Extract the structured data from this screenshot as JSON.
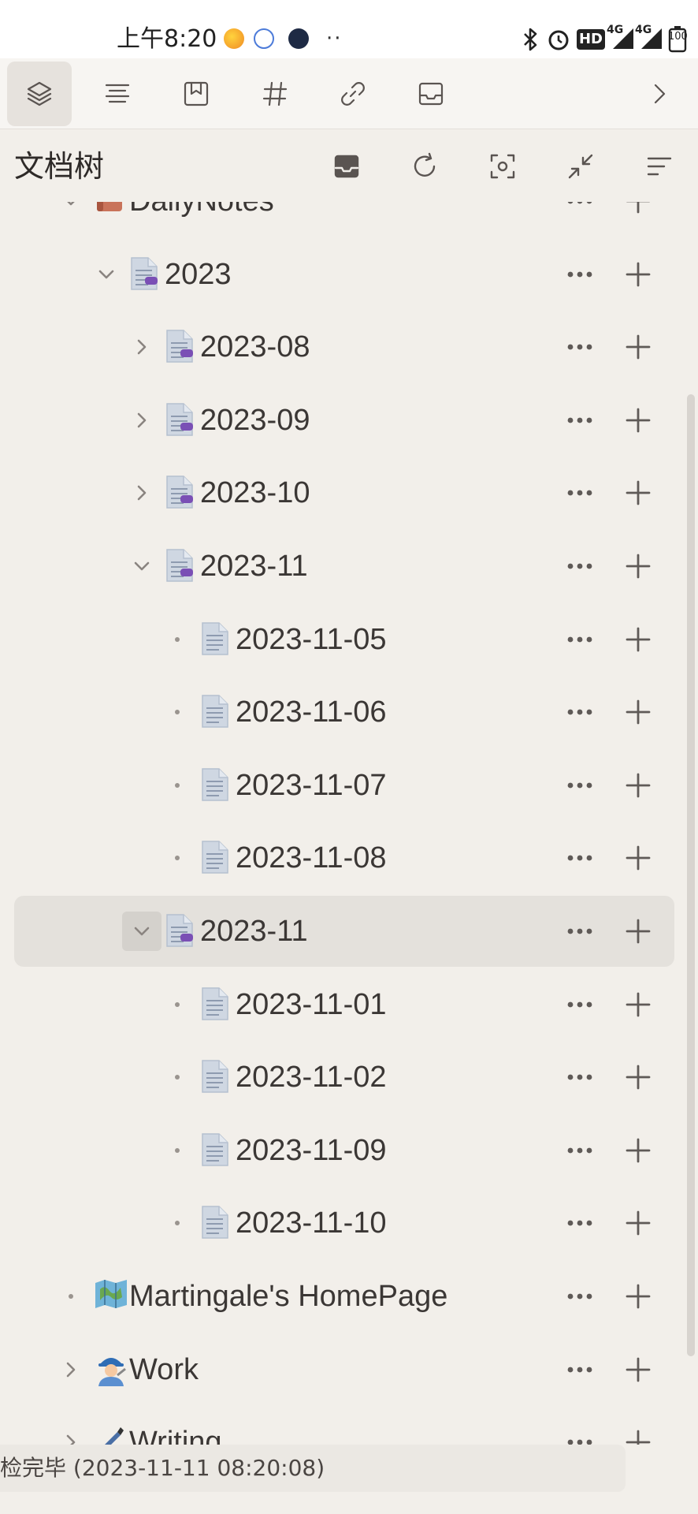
{
  "status_bar": {
    "time": "上午8:20",
    "hd_label": "HD",
    "network_1": "4G",
    "network_2": "4G",
    "battery": "100"
  },
  "dock_tabs": [
    {
      "icon": "layers-icon",
      "active": true
    },
    {
      "icon": "outline-icon",
      "active": false
    },
    {
      "icon": "bookmark-icon",
      "active": false
    },
    {
      "icon": "hashtag-icon",
      "active": false
    },
    {
      "icon": "link-icon",
      "active": false
    },
    {
      "icon": "inbox-icon",
      "active": false
    },
    {
      "icon": "chevron-right-icon",
      "active": false
    }
  ],
  "panel": {
    "title": "文档树",
    "actions": [
      "inbox-icon",
      "refresh-icon",
      "focus-icon",
      "collapse-icon",
      "sort-icon"
    ]
  },
  "tree": {
    "rows": [
      {
        "label": "DailyNotes",
        "level": 0,
        "toggle": "expanded",
        "icon": "book-emoji",
        "clipped": "top"
      },
      {
        "label": "2023",
        "level": 1,
        "toggle": "expanded",
        "icon": "doc-with-children"
      },
      {
        "label": "2023-08",
        "level": 2,
        "toggle": "collapsed",
        "icon": "doc-with-children"
      },
      {
        "label": "2023-09",
        "level": 2,
        "toggle": "collapsed",
        "icon": "doc-with-children"
      },
      {
        "label": "2023-10",
        "level": 2,
        "toggle": "collapsed",
        "icon": "doc-with-children"
      },
      {
        "label": "2023-11",
        "level": 2,
        "toggle": "expanded",
        "icon": "doc-with-children"
      },
      {
        "label": "2023-11-05",
        "level": 3,
        "toggle": "leaf",
        "icon": "doc"
      },
      {
        "label": "2023-11-06",
        "level": 3,
        "toggle": "leaf",
        "icon": "doc"
      },
      {
        "label": "2023-11-07",
        "level": 3,
        "toggle": "leaf",
        "icon": "doc"
      },
      {
        "label": "2023-11-08",
        "level": 3,
        "toggle": "leaf",
        "icon": "doc"
      },
      {
        "label": "2023-11",
        "level": 2,
        "toggle": "expanded",
        "icon": "doc-with-children",
        "selected": true
      },
      {
        "label": "2023-11-01",
        "level": 3,
        "toggle": "leaf",
        "icon": "doc"
      },
      {
        "label": "2023-11-02",
        "level": 3,
        "toggle": "leaf",
        "icon": "doc"
      },
      {
        "label": "2023-11-09",
        "level": 3,
        "toggle": "leaf",
        "icon": "doc"
      },
      {
        "label": "2023-11-10",
        "level": 3,
        "toggle": "leaf",
        "icon": "doc"
      },
      {
        "label": "Martingale's HomePage",
        "level": 0,
        "toggle": "leaf",
        "icon": "map-emoji"
      },
      {
        "label": "Work",
        "level": 0,
        "toggle": "collapsed",
        "icon": "worker-emoji"
      },
      {
        "label": "Writing",
        "level": 0,
        "toggle": "collapsed",
        "icon": "pen-emoji",
        "clipped": "bottom"
      }
    ]
  },
  "status_message": "检完毕 (2023-11-11 08:20:08)",
  "colors": {
    "background": "#f2efea",
    "selected_row": "#e4e1dc",
    "text": "#3b3735",
    "doc_badge": "#7a4fb5",
    "doc_icon": "#c9d3df"
  }
}
